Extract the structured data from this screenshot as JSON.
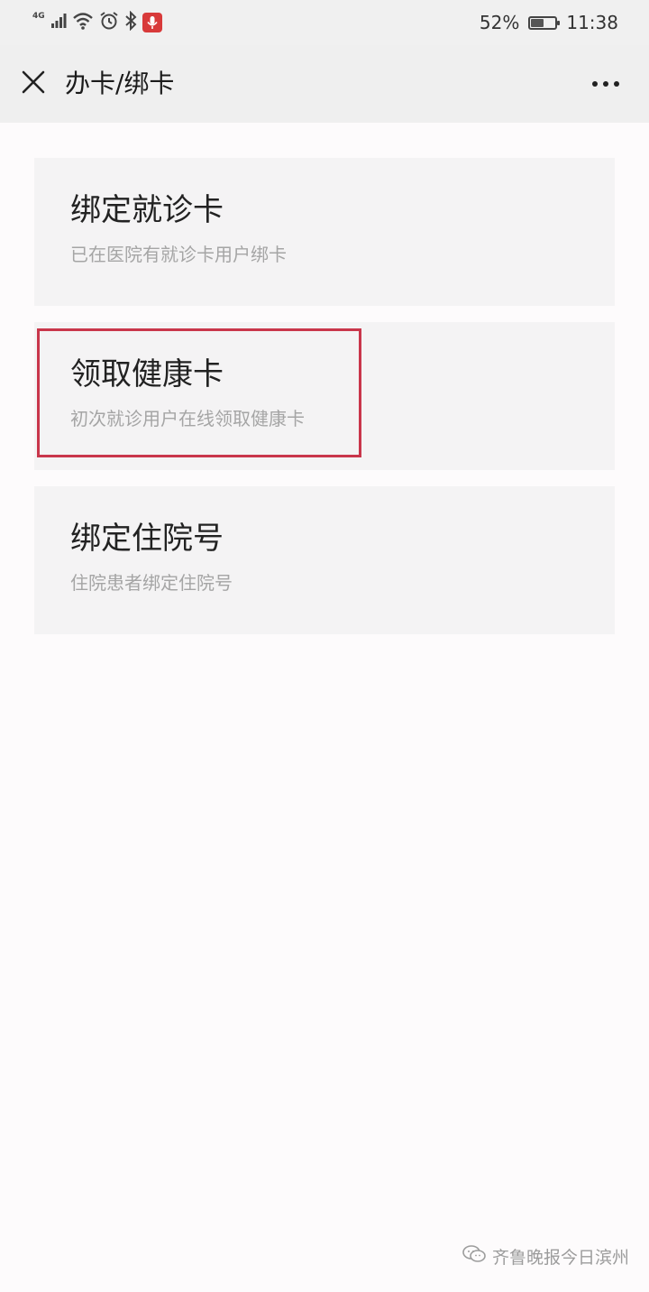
{
  "status_bar": {
    "network_label": "4G",
    "battery_text": "52%",
    "battery_level": 0.52,
    "time": "11:38",
    "icons": [
      "signal-icon",
      "wifi-icon",
      "alarm-icon",
      "bluetooth-icon",
      "microphone-icon",
      "battery-icon"
    ],
    "mic_color": "#d83a3a"
  },
  "header": {
    "title": "办卡/绑卡",
    "close_icon": "close-icon",
    "more_icon": "more-icon"
  },
  "cards": [
    {
      "title": "绑定就诊卡",
      "desc": "已在医院有就诊卡用户绑卡"
    },
    {
      "title": "领取健康卡",
      "desc": "初次就诊用户在线领取健康卡"
    },
    {
      "title": "绑定住院号",
      "desc": "住院患者绑定住院号"
    }
  ],
  "highlight": {
    "target": "领取健康卡",
    "color": "#c9364b"
  },
  "watermark": {
    "text": "齐鲁晚报今日滨州",
    "icon": "wechat-icon"
  }
}
